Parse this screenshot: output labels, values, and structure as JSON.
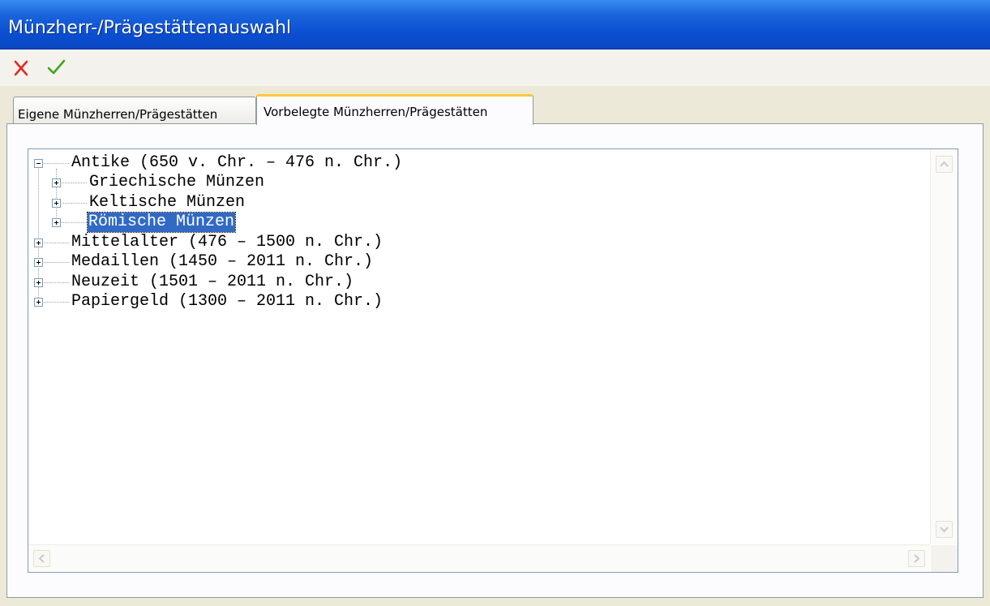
{
  "window": {
    "title": "Münzherr-/Prägestättenauswahl"
  },
  "toolbar": {
    "cancel_icon": "red-x-icon",
    "ok_icon": "green-check-icon",
    "cancel_color": "#e3281f",
    "ok_color": "#3aa51a"
  },
  "tabs": [
    {
      "label": "Eigene Münzherren/Prägestätten",
      "active": false
    },
    {
      "label": "Vorbelegte Münzherren/Prägestätten",
      "active": true
    }
  ],
  "tree": {
    "nodes": [
      {
        "label": "Antike (650 v. Chr. – 476 n. Chr.)",
        "expanded": true,
        "children": [
          {
            "label": "Griechische Münzen"
          },
          {
            "label": "Keltische Münzen"
          },
          {
            "label": "Römische Münzen",
            "selected": true
          }
        ]
      },
      {
        "label": "Mittelalter (476 – 1500 n. Chr.)"
      },
      {
        "label": "Medaillen (1450 – 2011 n. Chr.)"
      },
      {
        "label": "Neuzeit (1501 – 2011 n. Chr.)"
      },
      {
        "label": "Papiergeld (1300 – 2011 n. Chr.)"
      }
    ]
  },
  "colors": {
    "selection": "#316ac5",
    "titlebar": "#0a4fd0"
  }
}
